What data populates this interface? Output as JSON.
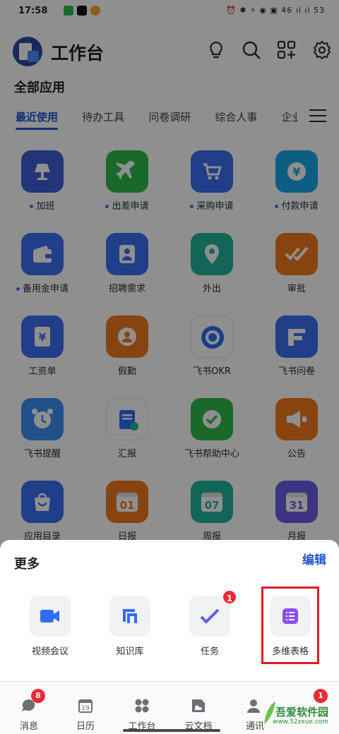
{
  "status_bar": {
    "time": "17:58",
    "right_text": "⏰ ✱ ⚡ ◉ ▣ 46 ıl ıl 53"
  },
  "header": {
    "title": "工作台"
  },
  "section_title": "全部应用",
  "tabs": [
    "最近使用",
    "待办工具",
    "问卷调研",
    "综合人事",
    "企业"
  ],
  "apps": [
    {
      "label": "加班",
      "dot": true,
      "color": "#3e5fd6",
      "icon": "lamp-icon"
    },
    {
      "label": "出差申请",
      "dot": true,
      "color": "#2dbb4d",
      "icon": "airplane-icon"
    },
    {
      "label": "采购申请",
      "dot": true,
      "color": "#3b6ff2",
      "icon": "cart-icon"
    },
    {
      "label": "付款申请",
      "dot": true,
      "color": "#17a9e8",
      "icon": "yen-coin-icon"
    },
    {
      "label": "备用金申请",
      "dot": true,
      "color": "#3b6ff2",
      "icon": "wallet-icon"
    },
    {
      "label": "招聘需求",
      "dot": false,
      "color": "#3b6ff2",
      "icon": "person-icon"
    },
    {
      "label": "外出",
      "dot": false,
      "color": "#22b59c",
      "icon": "location-icon"
    },
    {
      "label": "审批",
      "dot": false,
      "color": "#f07a1e",
      "icon": "approve-check-icon"
    },
    {
      "label": "工资单",
      "dot": false,
      "color": "#3b6ff2",
      "icon": "yen-doc-icon"
    },
    {
      "label": "假勤",
      "dot": false,
      "color": "#f07a1e",
      "icon": "person-badge-icon"
    },
    {
      "label": "飞书OKR",
      "dot": false,
      "color": "#ffffff",
      "icon": "okr-ring-icon"
    },
    {
      "label": "飞书问卷",
      "dot": false,
      "color": "#3b6ff2",
      "icon": "questionnaire-icon"
    },
    {
      "label": "飞书提醒",
      "dot": false,
      "color": "#3d8ff5",
      "icon": "alarm-clock-icon"
    },
    {
      "label": "汇报",
      "dot": false,
      "color": "#ffffff",
      "icon": "report-doc-icon"
    },
    {
      "label": "飞书帮助中心",
      "dot": false,
      "color": "#2dbb4d",
      "icon": "help-check-icon"
    },
    {
      "label": "公告",
      "dot": false,
      "color": "#f07a1e",
      "icon": "megaphone-icon"
    },
    {
      "label": "应用目录",
      "dot": false,
      "color": "#3b6ff2",
      "icon": "bag-icon",
      "badge_text": ""
    },
    {
      "label": "日报",
      "dot": false,
      "color": "#f07a1e",
      "icon": "calendar-icon",
      "cal_num": "01"
    },
    {
      "label": "周报",
      "dot": false,
      "color": "#22b59c",
      "icon": "calendar-icon",
      "cal_num": "07"
    },
    {
      "label": "月报",
      "dot": false,
      "color": "#6c5ce7",
      "icon": "calendar-icon",
      "cal_num": "31"
    }
  ],
  "sheet": {
    "title": "更多",
    "edit": "编辑",
    "items": [
      {
        "label": "视频会议",
        "icon": "video-camera-icon",
        "badge": ""
      },
      {
        "label": "知识库",
        "icon": "knowledge-base-icon",
        "badge": ""
      },
      {
        "label": "任务",
        "icon": "task-check-icon",
        "badge": "1"
      },
      {
        "label": "多维表格",
        "icon": "bitable-icon",
        "badge": ""
      }
    ]
  },
  "nav": [
    {
      "label": "消息",
      "badge": "8",
      "icon": "chat-bubble-icon"
    },
    {
      "label": "日历",
      "badge": "",
      "icon": "calendar-nav-icon",
      "num": "19"
    },
    {
      "label": "工作台",
      "badge": "",
      "icon": "grid-dots-icon"
    },
    {
      "label": "云文档",
      "badge": "",
      "icon": "cloud-doc-icon"
    },
    {
      "label": "通讯",
      "badge": "",
      "icon": "contacts-icon"
    },
    {
      "label": "",
      "badge": "1",
      "icon": "more-icon"
    }
  ],
  "watermark": {
    "brand": "吾爱软件园",
    "url": "www.52zxue.com"
  },
  "colors": {
    "accent": "#1f55d6",
    "badge": "#ee2936",
    "highlight": "#e01b24"
  }
}
